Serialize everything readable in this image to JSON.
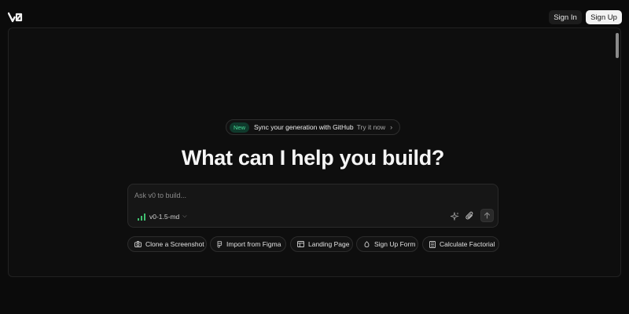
{
  "header": {
    "logo_text": "v0",
    "signin_label": "Sign In",
    "signup_label": "Sign Up"
  },
  "announcement": {
    "badge": "New",
    "text": "Sync your generation with GitHub",
    "cta": "Try it now",
    "chevron": "›"
  },
  "hero": {
    "headline": "What can I help you build?"
  },
  "prompt": {
    "placeholder": "Ask v0 to build...",
    "value": "",
    "model": "v0-1.5-md",
    "icons": [
      "sparkle-icon",
      "paperclip-icon",
      "arrow-up-icon"
    ]
  },
  "suggestions": [
    {
      "label": "Clone a Screenshot",
      "icon": "camera-icon"
    },
    {
      "label": "Import from Figma",
      "icon": "figma-icon"
    },
    {
      "label": "Landing Page",
      "icon": "layout-icon"
    },
    {
      "label": "Sign Up Form",
      "icon": "user-plus-icon"
    },
    {
      "label": "Calculate Factorial",
      "icon": "calculator-icon"
    }
  ],
  "colors": {
    "background": "#0b0b0b",
    "panel": "#0e0e0e",
    "badge_bg": "#0f3a2c",
    "badge_text": "#4ade9a",
    "signup_bg": "#f3f3f3",
    "model_bars": "#3fbf6f"
  }
}
